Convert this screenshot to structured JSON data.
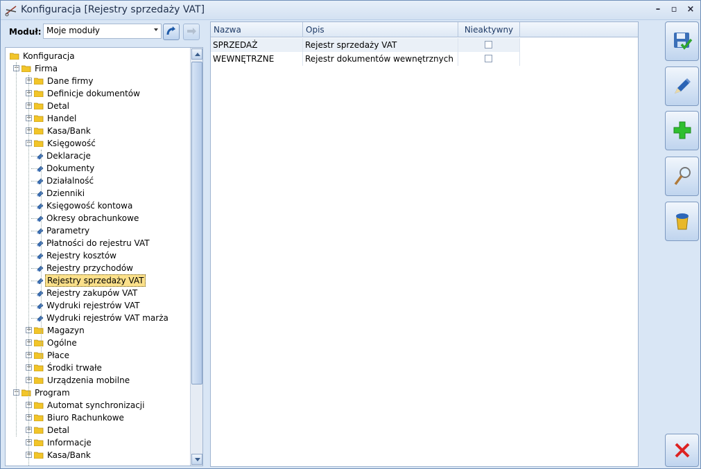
{
  "window": {
    "title": "Konfiguracja [Rejestry sprzedaży VAT]"
  },
  "toolbar": {
    "modul_label": "Moduł:",
    "modul_value": "Moje moduły"
  },
  "tree": [
    {
      "label": "Konfiguracja",
      "level": 0,
      "type": "folder",
      "expand": "none"
    },
    {
      "label": "Firma",
      "level": 1,
      "type": "folder",
      "expand": "minus"
    },
    {
      "label": "Dane firmy",
      "level": 2,
      "type": "folder",
      "expand": "plus"
    },
    {
      "label": "Definicje dokumentów",
      "level": 2,
      "type": "folder",
      "expand": "plus"
    },
    {
      "label": "Detal",
      "level": 2,
      "type": "folder",
      "expand": "plus"
    },
    {
      "label": "Handel",
      "level": 2,
      "type": "folder",
      "expand": "plus"
    },
    {
      "label": "Kasa/Bank",
      "level": 2,
      "type": "folder",
      "expand": "plus"
    },
    {
      "label": "Księgowość",
      "level": 2,
      "type": "folder",
      "expand": "minus"
    },
    {
      "label": "Deklaracje",
      "level": 3,
      "type": "leaf"
    },
    {
      "label": "Dokumenty",
      "level": 3,
      "type": "leaf"
    },
    {
      "label": "Działalność",
      "level": 3,
      "type": "leaf"
    },
    {
      "label": "Dzienniki",
      "level": 3,
      "type": "leaf"
    },
    {
      "label": "Księgowość kontowa",
      "level": 3,
      "type": "leaf"
    },
    {
      "label": "Okresy obrachunkowe",
      "level": 3,
      "type": "leaf"
    },
    {
      "label": "Parametry",
      "level": 3,
      "type": "leaf"
    },
    {
      "label": "Płatności do rejestru VAT",
      "level": 3,
      "type": "leaf"
    },
    {
      "label": "Rejestry kosztów",
      "level": 3,
      "type": "leaf"
    },
    {
      "label": "Rejestry przychodów",
      "level": 3,
      "type": "leaf"
    },
    {
      "label": "Rejestry sprzedaży VAT",
      "level": 3,
      "type": "leaf",
      "selected": true
    },
    {
      "label": "Rejestry zakupów VAT",
      "level": 3,
      "type": "leaf"
    },
    {
      "label": "Wydruki rejestrów VAT",
      "level": 3,
      "type": "leaf"
    },
    {
      "label": "Wydruki rejestrów VAT marża",
      "level": 3,
      "type": "leaf"
    },
    {
      "label": "Magazyn",
      "level": 2,
      "type": "folder",
      "expand": "plus"
    },
    {
      "label": "Ogólne",
      "level": 2,
      "type": "folder",
      "expand": "plus"
    },
    {
      "label": "Płace",
      "level": 2,
      "type": "folder",
      "expand": "plus"
    },
    {
      "label": "Środki trwałe",
      "level": 2,
      "type": "folder",
      "expand": "plus"
    },
    {
      "label": "Urządzenia mobilne",
      "level": 2,
      "type": "folder",
      "expand": "plus"
    },
    {
      "label": "Program",
      "level": 1,
      "type": "folder",
      "expand": "minus"
    },
    {
      "label": "Automat synchronizacji",
      "level": 2,
      "type": "folder",
      "expand": "plus"
    },
    {
      "label": "Biuro Rachunkowe",
      "level": 2,
      "type": "folder",
      "expand": "plus"
    },
    {
      "label": "Detal",
      "level": 2,
      "type": "folder",
      "expand": "plus"
    },
    {
      "label": "Informacje",
      "level": 2,
      "type": "folder",
      "expand": "plus"
    },
    {
      "label": "Kasa/Bank",
      "level": 2,
      "type": "folder",
      "expand": "plus"
    }
  ],
  "grid": {
    "columns": [
      "Nazwa",
      "Opis",
      "Nieaktywny"
    ],
    "rows": [
      {
        "nazwa": "SPRZEDAŻ",
        "opis": "Rejestr sprzedaży VAT",
        "nieaktywny": false
      },
      {
        "nazwa": "WEWNĘTRZNE",
        "opis": "Rejestr dokumentów wewnętrznych",
        "nieaktywny": false
      }
    ]
  },
  "actions": [
    {
      "name": "save-button",
      "icon": "save-icon"
    },
    {
      "name": "edit-button",
      "icon": "edit-icon"
    },
    {
      "name": "add-button",
      "icon": "plus-icon"
    },
    {
      "name": "preview-button",
      "icon": "magnifier-icon"
    },
    {
      "name": "delete-button",
      "icon": "trash-icon"
    },
    {
      "name": "close-button",
      "icon": "close-icon"
    }
  ],
  "colors": {
    "selection": "#fbe08a",
    "accent": "#3a6fb5",
    "add": "#2fbf2f",
    "close": "#d22"
  }
}
